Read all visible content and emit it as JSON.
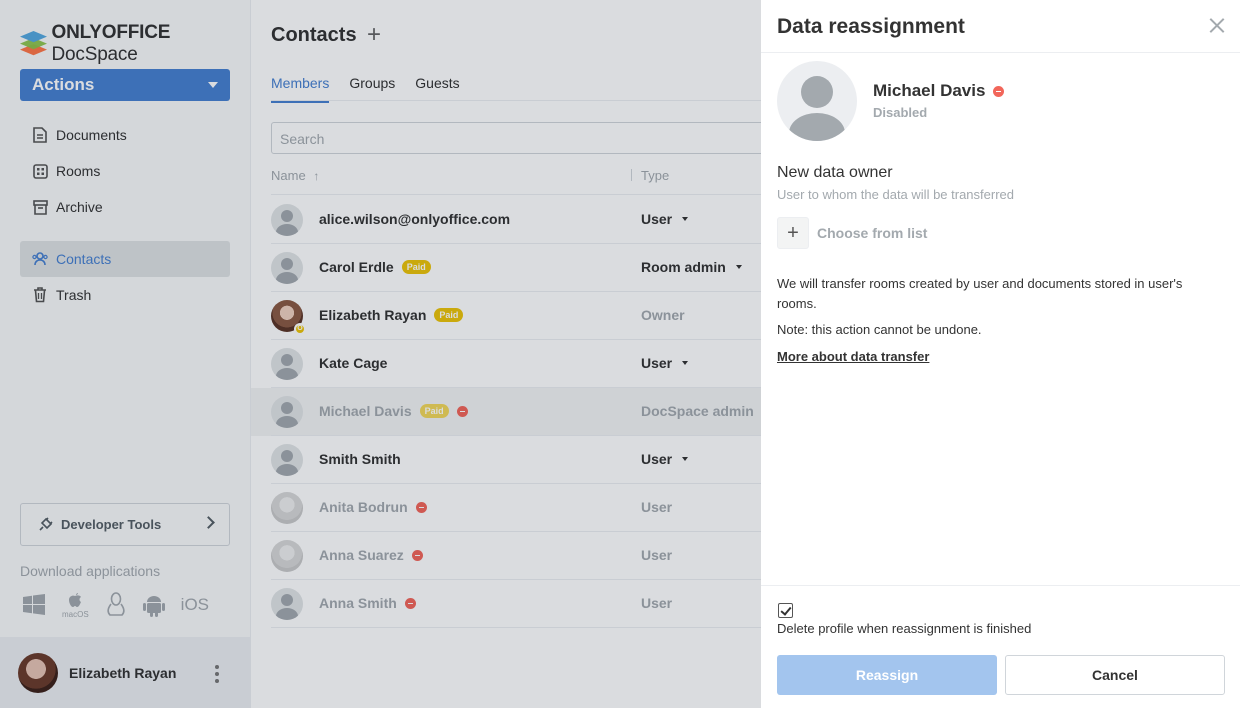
{
  "app": {
    "brand_bold": "ONLYOFFICE",
    "brand_light": " DocSpace"
  },
  "sidebar": {
    "actions_label": "Actions",
    "items": [
      {
        "label": "Documents",
        "icon": "document-icon"
      },
      {
        "label": "Rooms",
        "icon": "rooms-icon"
      },
      {
        "label": "Archive",
        "icon": "archive-icon"
      },
      {
        "label": "Contacts",
        "icon": "contacts-icon",
        "active": true
      },
      {
        "label": "Trash",
        "icon": "trash-icon"
      }
    ],
    "developer_tools": "Developer Tools",
    "download_title": "Download applications",
    "apps": {
      "macos_label": "macOS",
      "ios_label": "iOS"
    },
    "profile_name": "Elizabeth Rayan"
  },
  "main": {
    "title": "Contacts",
    "tabs": [
      "Members",
      "Groups",
      "Guests"
    ],
    "search_placeholder": "Search",
    "columns": {
      "name": "Name",
      "type": "Type"
    },
    "sort_indicator": "↑",
    "rows": [
      {
        "name": "alice.wilson@onlyoffice.com",
        "type": "User",
        "paid": "",
        "disabled": false
      },
      {
        "name": "Carol Erdle",
        "type": "Room admin",
        "paid": "Paid",
        "disabled": false
      },
      {
        "name": "Elizabeth Rayan",
        "type": "Owner",
        "paid": "Paid",
        "disabled": false
      },
      {
        "name": "Kate Cage",
        "type": "User",
        "paid": "",
        "disabled": false
      },
      {
        "name": "Michael Davis",
        "type": "DocSpace admin",
        "paid": "Paid",
        "disabled": true
      },
      {
        "name": "Smith Smith",
        "type": "User",
        "paid": "",
        "disabled": false
      },
      {
        "name": "Anita Bodrun",
        "type": "User",
        "paid": "",
        "disabled": true
      },
      {
        "name": "Anna Suarez",
        "type": "User",
        "paid": "",
        "disabled": true
      },
      {
        "name": "Anna Smith",
        "type": "User",
        "paid": "",
        "disabled": true
      }
    ],
    "owner_badge": "O"
  },
  "panel": {
    "title": "Data reassignment",
    "user_name": "Michael Davis",
    "user_status": "Disabled",
    "section_title": "New data owner",
    "section_sub": "User to whom the data will be transferred",
    "choose_plus": "+",
    "choose_label": "Choose from list",
    "info": "We will transfer rooms created by user and documents stored in user's rooms.",
    "note": "Note: this action cannot be undone.",
    "more_link": "More about data transfer",
    "checkbox_label": "Delete profile when reassignment is finished",
    "checkbox_checked": true,
    "reassign_label": "Reassign",
    "cancel_label": "Cancel"
  },
  "colors": {
    "accent": "#4781d1",
    "paid": "#edc409",
    "disabled": "#f2665a",
    "reassign_disabled": "#a3c5ee"
  }
}
